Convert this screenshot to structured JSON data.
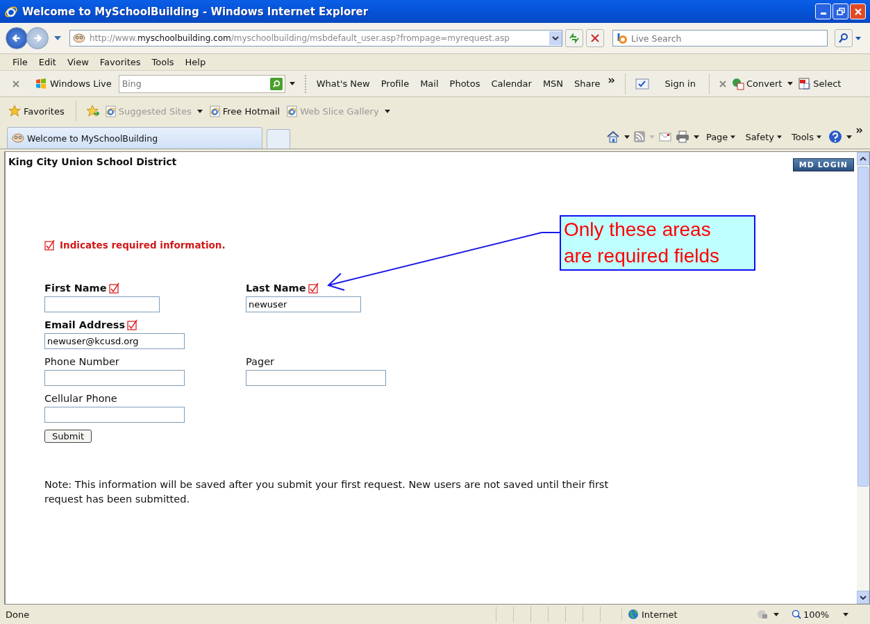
{
  "window": {
    "title": "Welcome to MySchoolBuilding - Windows Internet Explorer"
  },
  "address_bar": {
    "url_prefix": "http://www.",
    "url_domain": "myschoolbuilding.com",
    "url_path": "/myschoolbuilding/msbdefault_user.asp?frompage=myrequest.asp",
    "search_placeholder": "Live Search"
  },
  "menu": [
    "File",
    "Edit",
    "View",
    "Favorites",
    "Tools",
    "Help"
  ],
  "live_toolbar": {
    "brand": "Windows Live",
    "search_placeholder": "Bing",
    "links": [
      "What's New",
      "Profile",
      "Mail",
      "Photos",
      "Calendar",
      "MSN",
      "Share"
    ],
    "sign_in": "Sign in",
    "convert": "Convert",
    "select": "Select"
  },
  "favorites_bar": {
    "label": "Favorites",
    "items": [
      {
        "label": "Suggested Sites",
        "disabled": true,
        "dropdown": true
      },
      {
        "label": "Free Hotmail",
        "disabled": false,
        "dropdown": false
      },
      {
        "label": "Web Slice Gallery",
        "disabled": true,
        "dropdown": true
      }
    ]
  },
  "tabs": [
    {
      "label": "Welcome to MySchoolBuilding",
      "selected": true
    }
  ],
  "command_bar": [
    "Page",
    "Safety",
    "Tools"
  ],
  "page": {
    "district": "King City Union School District",
    "login_button": "MD LOGIN",
    "legend": "Indicates required information.",
    "field_rows": [
      [
        {
          "label": "First Name",
          "required": true
        },
        {
          "label": "Last Name",
          "required": true,
          "value": "newuser"
        }
      ],
      [
        {
          "label": "Email Address",
          "required": true,
          "value": "newuser@kcusd.org"
        }
      ],
      [
        {
          "label": "Phone Number",
          "required": false
        },
        {
          "label": "Pager",
          "required": false
        }
      ],
      [
        {
          "label": "Cellular Phone",
          "required": false
        }
      ]
    ],
    "submit": "Submit",
    "note": "Note: This information will be saved after you submit your first request. New users are not saved until their first request has been submitted."
  },
  "callout": {
    "text": "Only these areas are required fields"
  },
  "status_bar": {
    "status": "Done",
    "zone": "Internet",
    "zoom": "100%"
  }
}
